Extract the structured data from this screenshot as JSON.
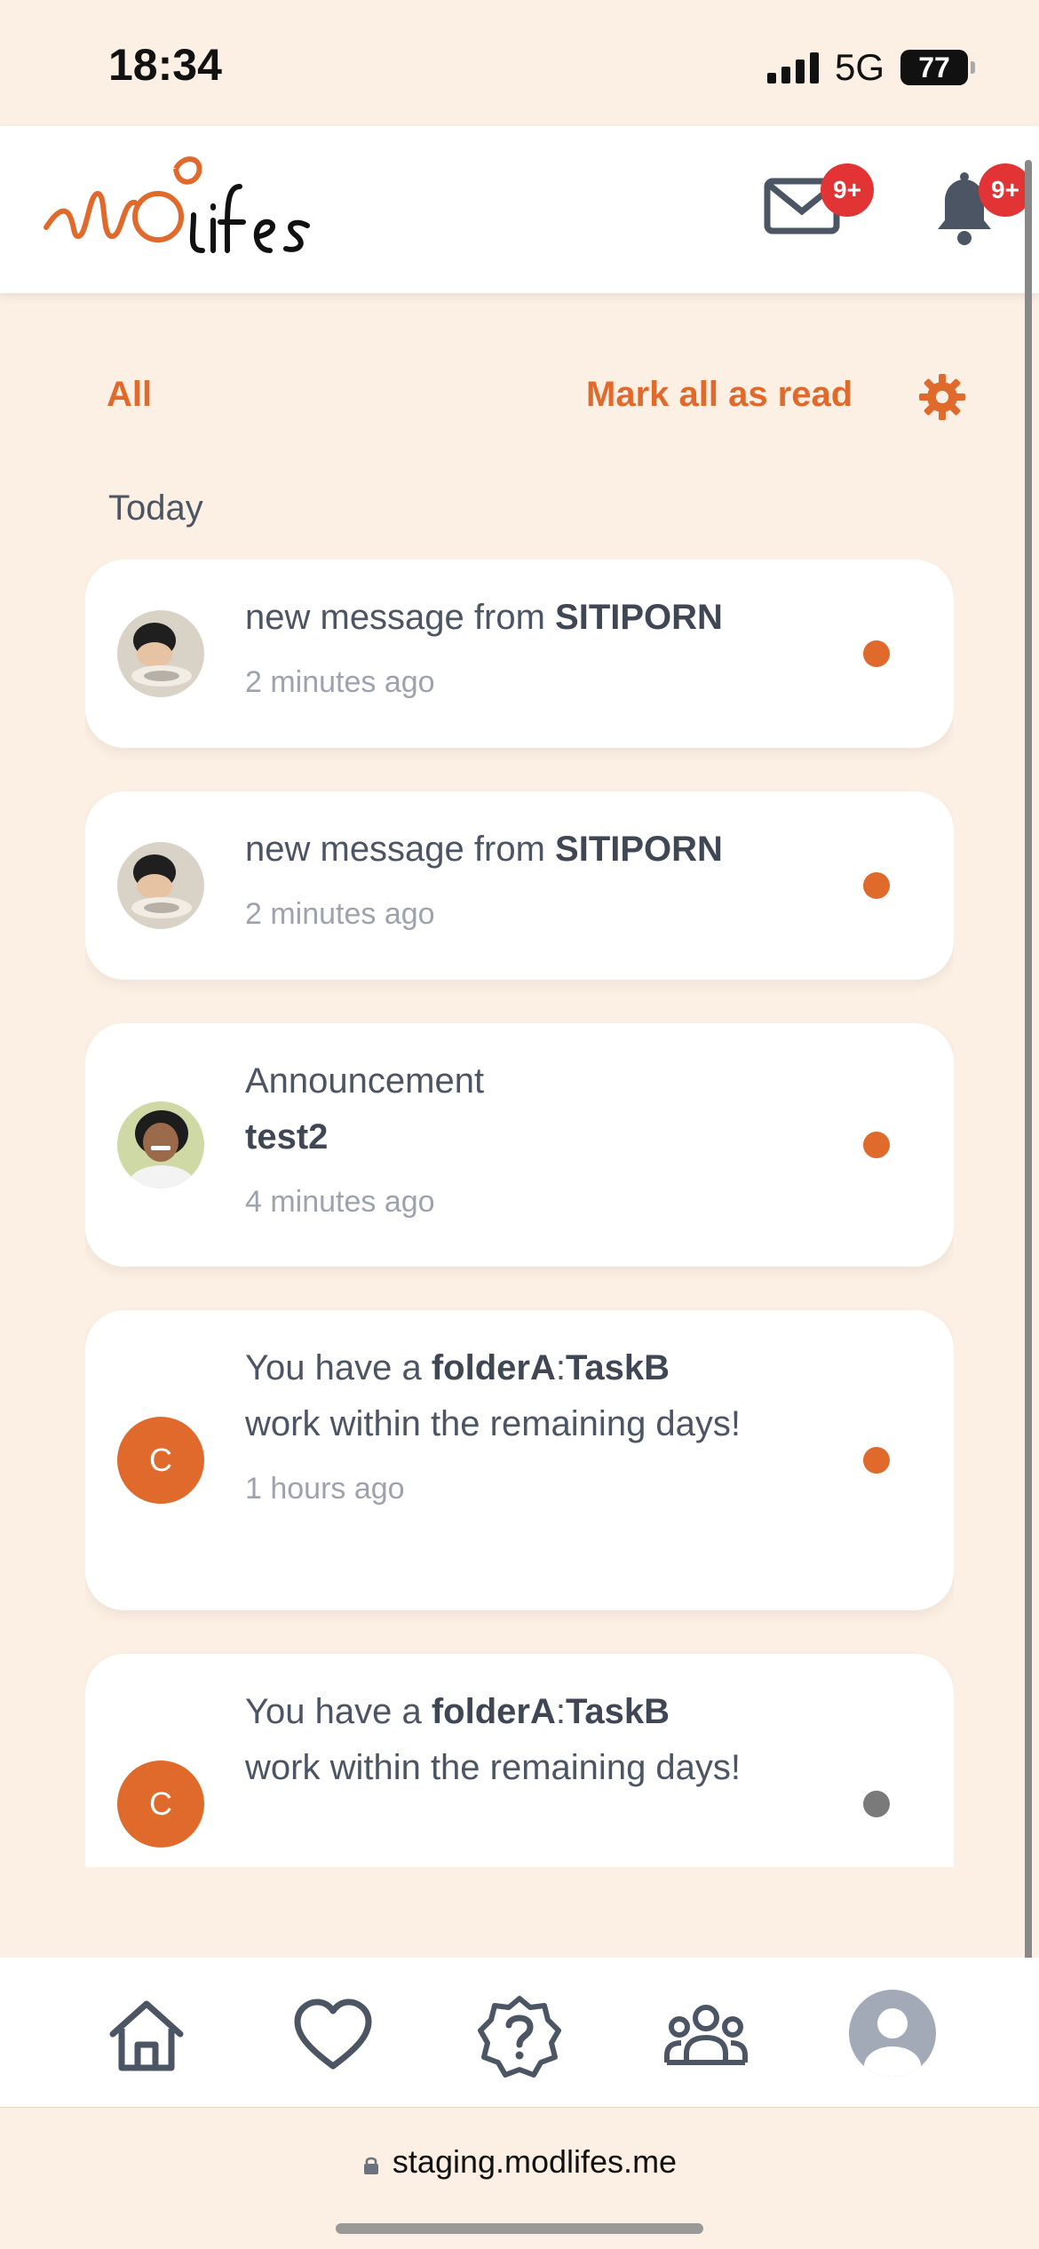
{
  "status_bar": {
    "time": "18:34",
    "network": "5G",
    "battery": "77"
  },
  "header": {
    "logo_alt": "ModLifes",
    "mail_badge": "9+",
    "bell_badge": "9+"
  },
  "filters": {
    "all_label": "All",
    "mark_all_label": "Mark all as read"
  },
  "section_title": "Today",
  "notifications": [
    {
      "prefix": "new message from ",
      "bold": "SITIPORN",
      "suffix": "",
      "time": "2 minutes ago",
      "unread": true,
      "avatar": "photo-boy"
    },
    {
      "prefix": "new message from ",
      "bold": "SITIPORN",
      "suffix": "",
      "time": "2 minutes ago",
      "unread": true,
      "avatar": "photo-boy"
    },
    {
      "title": "Announcement",
      "bold": "test2",
      "time": "4 minutes ago",
      "unread": true,
      "avatar": "photo-woman"
    },
    {
      "prefix": "You have a ",
      "bold": "folderA",
      "sep": ":",
      "bold2": "TaskB",
      "suffix": " work within the remaining days!",
      "time": "1 hours ago",
      "unread": true,
      "avatar_letter": "C"
    },
    {
      "prefix": "You have a ",
      "bold": "folderA",
      "sep": ":",
      "bold2": "TaskB",
      "suffix": " work within the remaining days!",
      "time": "",
      "unread": false,
      "avatar_letter": "C"
    }
  ],
  "bottom_nav": [
    "home-icon",
    "heart-icon",
    "help-icon",
    "community-icon",
    "profile-icon"
  ],
  "browser": {
    "url": "staging.modlifes.me"
  },
  "colors": {
    "accent": "#e06a2c",
    "background": "#fcf0e4",
    "badge": "#e23434"
  }
}
